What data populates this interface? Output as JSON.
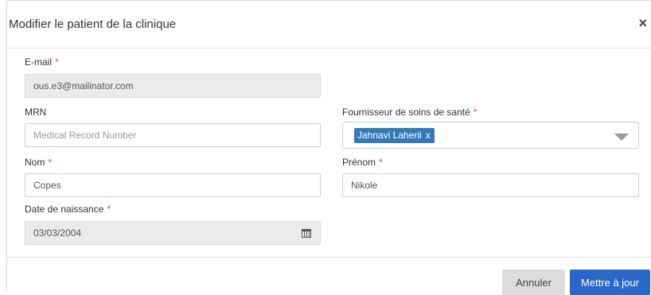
{
  "modal": {
    "title": "Modifier le patient de la clinique"
  },
  "form": {
    "email": {
      "label": "E-mail",
      "required_mark": "*",
      "value": "ous.e3@mailinator.com"
    },
    "mrn": {
      "label": "MRN",
      "placeholder": "Medical Record Number",
      "value": ""
    },
    "provider": {
      "label": "Fournisseur de soins de santé",
      "required_mark": "*",
      "selected": "Jahnavi Laherii",
      "remove_glyph": "x"
    },
    "last_name": {
      "label": "Nom",
      "required_mark": "*",
      "value": "Copes"
    },
    "first_name": {
      "label": "Prénom",
      "required_mark": "*",
      "value": "Nikole"
    },
    "dob": {
      "label": "Date de naissance",
      "required_mark": "*",
      "value": "03/03/2004"
    }
  },
  "footer": {
    "cancel_label": "Annuler",
    "save_label": "Mettre à jour"
  },
  "icons": {
    "close": "close-icon",
    "calendar": "calendar-icon",
    "dropdown": "chevron-down-icon"
  },
  "colors": {
    "primary": "#2a67c7",
    "tag": "#337ab7",
    "required": "#d9534f",
    "disabled_bg": "#ebebeb"
  }
}
